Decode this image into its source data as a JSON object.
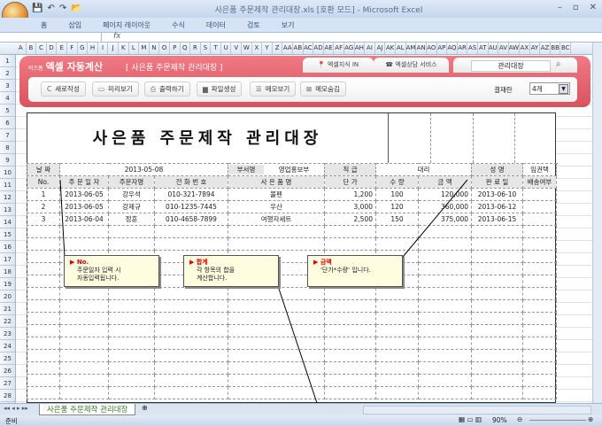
{
  "window": {
    "title": "사은품 주문제작 관리대장.xls  [호환 모드] - Microsoft Excel"
  },
  "ribbon_tabs": [
    "홈",
    "삽입",
    "페이지 레이아웃",
    "수식",
    "데이터",
    "검토",
    "보기"
  ],
  "formula_bar": {
    "fx": "fx",
    "value": ""
  },
  "columns": [
    "A",
    "B",
    "C",
    "D",
    "E",
    "F",
    "G",
    "H",
    "I",
    "J",
    "K",
    "L",
    "M",
    "N",
    "O",
    "P",
    "Q",
    "R",
    "S",
    "T",
    "U",
    "V",
    "W",
    "X",
    "Y",
    "Z",
    "AA",
    "AB",
    "AC",
    "AD",
    "AE",
    "AF",
    "AG",
    "AH",
    "AI",
    "AJ",
    "AK",
    "AL",
    "AM",
    "AN",
    "AO",
    "AP",
    "AQ",
    "AR",
    "AS",
    "AT",
    "AU",
    "AV",
    "AW",
    "AX",
    "AY",
    "AZ",
    "BB",
    "BC"
  ],
  "rows": [
    "1",
    "2",
    "3",
    "4",
    "5",
    "6",
    "7",
    "8",
    "9",
    "10",
    "11",
    "12",
    "13",
    "14",
    "15",
    "16",
    "17",
    "18",
    "19",
    "20",
    "21",
    "22",
    "23",
    "24",
    "25",
    "26",
    "27",
    "28"
  ],
  "banner": {
    "brand_small": "비즈폼",
    "brand": "엑셀 자동계산",
    "subtitle": "[ 사은품 주문제작 관리대장 ]",
    "tab1": "엑셀지식 IN",
    "tab2": "엑셀상담 서비스",
    "search": "관리대장",
    "buttons": [
      "새로작성",
      "미리보기",
      "출력하기",
      "파일생성",
      "메모보기",
      "메모숨김"
    ],
    "approval_label": "결재란",
    "approval_value": "4개"
  },
  "doc": {
    "title": "사은품 주문제작 관리대장",
    "info": {
      "date_label": "날 짜",
      "date": "2013-05-08",
      "dept_label": "부서명",
      "dept": "영업홍보부",
      "rank_label": "직 급",
      "rank": "대리",
      "name_label": "성 명",
      "name": "임권택"
    },
    "headers": [
      "No.",
      "주 문 일 자",
      "주문자명",
      "전 화 번 호",
      "사 은 품 명",
      "단    가",
      "수  량",
      "금    액",
      "완 료 일",
      "배송여부"
    ],
    "rows": [
      [
        "1",
        "2013-06-05",
        "강우석",
        "010-321-7894",
        "볼펜",
        "1,200",
        "100",
        "120,000",
        "2013-06-10",
        ""
      ],
      [
        "2",
        "2013-06-05",
        "강제규",
        "010-1235-7445",
        "우산",
        "3,000",
        "120",
        "360,000",
        "2013-06-12",
        ""
      ],
      [
        "3",
        "2013-06-04",
        "정훈",
        "010-4658-7899",
        "여행자세트",
        "2,500",
        "150",
        "375,000",
        "2013-06-15",
        ""
      ]
    ]
  },
  "callouts": [
    {
      "title": "No.",
      "text1": "주문일자 입력 시",
      "text2": "자동입력됩니다."
    },
    {
      "title": "합계",
      "text1": "각 항목의 합을",
      "text2": "계산합니다."
    },
    {
      "title": "금액",
      "text1": "'단가*수량' 입니다.",
      "text2": ""
    }
  ],
  "sheet_tab": "사은품 주문제작 관리대장",
  "status": {
    "ready": "준비",
    "zoom": "90%"
  }
}
